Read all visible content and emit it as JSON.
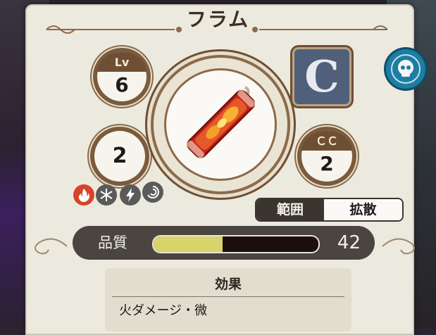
{
  "item": {
    "name": "フラム",
    "level_label": "Lv",
    "level": "6",
    "count": "2",
    "category_letter": "C",
    "cc_label": "ＣＣ",
    "cc": "2"
  },
  "elements": [
    "fire-icon",
    "ice-icon",
    "lightning-icon",
    "wind-icon"
  ],
  "range": {
    "label": "範囲",
    "value": "拡散"
  },
  "quality": {
    "label": "品質",
    "value": "42",
    "fill_fraction": 0.42
  },
  "effect": {
    "header": "効果",
    "lines": [
      "火ダメージ・微"
    ]
  },
  "colors": {
    "panel": "#eceadf",
    "brown": "#6f4f33",
    "fire": "#d8432b",
    "quality_fill": "#d8d36a",
    "category_bg": "#50607a",
    "skull_bg": "#1f7da2"
  }
}
